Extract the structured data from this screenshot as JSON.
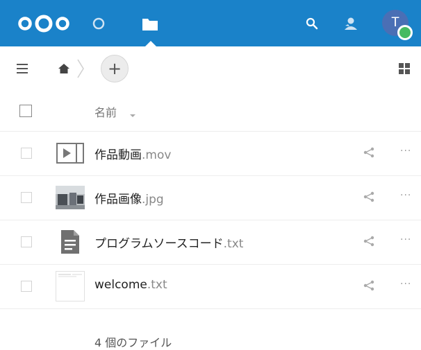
{
  "topbar": {
    "logo_icon": "nextcloud-logo",
    "nav": [
      {
        "name": "activity",
        "icon": "circle-icon"
      },
      {
        "name": "files",
        "icon": "folder-icon",
        "active": true
      }
    ],
    "search_icon": "search-icon",
    "contacts_icon": "contacts-icon",
    "avatar": {
      "initial": "T",
      "status": "online"
    },
    "accent_color": "#1a82c9"
  },
  "controls": {
    "menu_icon": "hamburger-icon",
    "breadcrumb_home_icon": "home-icon",
    "add_label": "+",
    "view_toggle_icon": "grid-icon"
  },
  "list": {
    "header_name": "名前",
    "sort_indicator": "chevron-down-icon",
    "files": [
      {
        "base": "作品動画",
        "ext": ".mov",
        "icon": "video-icon"
      },
      {
        "base": "作品画像",
        "ext": ".jpg",
        "icon": "image-thumbnail"
      },
      {
        "base": "プログラムソースコード",
        "ext": ".txt",
        "icon": "text-file-icon"
      },
      {
        "base": "welcome",
        "ext": ".txt",
        "icon": "text-preview-thumbnail"
      }
    ],
    "more_label": "···"
  },
  "footer": {
    "summary": "4 個のファイル"
  }
}
